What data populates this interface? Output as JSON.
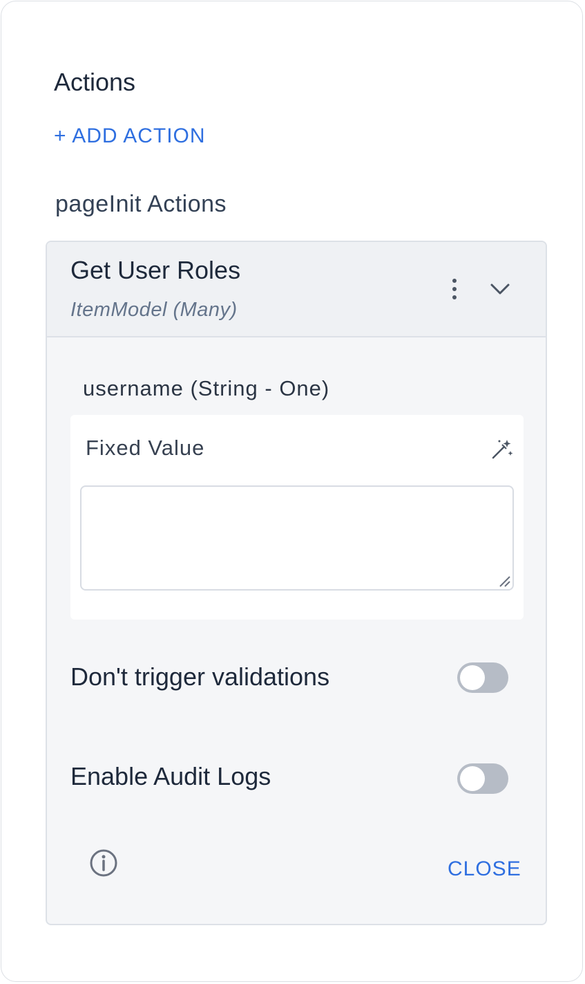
{
  "panel": {
    "title": "Actions",
    "add_action_label": "+ ADD ACTION",
    "section_title": "pageInit Actions"
  },
  "action_card": {
    "title": "Get User Roles",
    "subtitle": "ItemModel (Many)",
    "parameter": {
      "label": "username (String - One)",
      "value_type": "Fixed Value",
      "value": ""
    },
    "toggles": [
      {
        "label": "Don't trigger validations",
        "on": false
      },
      {
        "label": "Enable Audit Logs",
        "on": false
      }
    ],
    "close_label": "CLOSE"
  },
  "colors": {
    "accent": "#2f6fe0",
    "toggle_off": "#b6bcc6",
    "card_bg": "#f5f6f8",
    "header_bg": "#eff1f4"
  },
  "icons": {
    "menu": "kebab-icon",
    "expand": "chevron-down-icon",
    "magic": "magic-wand-icon",
    "info": "info-icon"
  }
}
